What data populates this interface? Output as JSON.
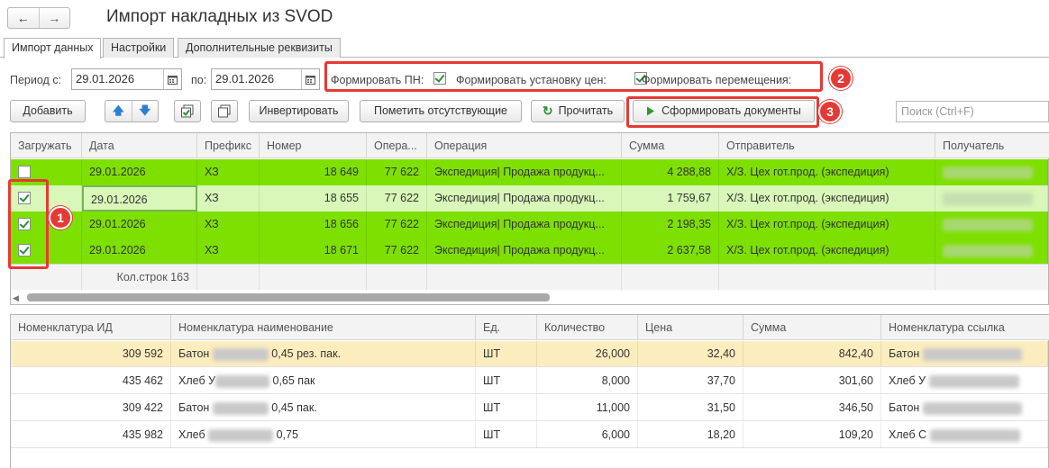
{
  "window": {
    "title": "Импорт накладных из SVOD"
  },
  "nav": {
    "back": "←",
    "forward": "→"
  },
  "tabs": [
    "Импорт данных",
    "Настройки",
    "Дополнительные реквизиты"
  ],
  "filters": {
    "period_from_label": "Период с:",
    "period_from": "29.01.2026",
    "period_to_label": "по:",
    "period_to": "29.01.2026",
    "form_pn_label": "Формировать ПН:",
    "form_prices_label": "Формировать установку цен:",
    "form_moves_label": "Формировать перемещения:",
    "form_pn": true,
    "form_prices": true,
    "form_moves": true
  },
  "toolbar": {
    "add": "Добавить",
    "invert": "Инвертировать",
    "mark_missing": "Пометить отсутствующие",
    "read": "Прочитать",
    "generate": "Сформировать документы",
    "search_placeholder": "Поиск (Ctrl+F)"
  },
  "badges": [
    "1",
    "2",
    "3"
  ],
  "top_table": {
    "columns": [
      "Загружать",
      "Дата",
      "Префикс",
      "Номер",
      "Опера...",
      "Операция",
      "Сумма",
      "Отправитель",
      "Получатель"
    ],
    "rows": [
      {
        "load": false,
        "date": "29.01.2026",
        "prefix": "ХЗ",
        "number": "18 649",
        "op_code": "77 622",
        "operation": "Экспедиция| Продажа продукц...",
        "sum": "4 288,88",
        "sender": "Х/З. Цех гот.прод. (экспедиция)"
      },
      {
        "load": true,
        "date": "29.01.2026",
        "prefix": "ХЗ",
        "number": "18 655",
        "op_code": "77 622",
        "operation": "Экспедиция| Продажа продукц...",
        "sum": "1 759,67",
        "sender": "Х/З. Цех гот.прод. (экспедиция)"
      },
      {
        "load": true,
        "date": "29.01.2026",
        "prefix": "ХЗ",
        "number": "18 656",
        "op_code": "77 622",
        "operation": "Экспедиция| Продажа продукц...",
        "sum": "2 198,35",
        "sender": "Х/З. Цех гот.прод. (экспедиция)"
      },
      {
        "load": true,
        "date": "29.01.2026",
        "prefix": "ХЗ",
        "number": "18 671",
        "op_code": "77 622",
        "operation": "Экспедиция| Продажа продукц...",
        "sum": "2 637,58",
        "sender": "Х/З. Цех гот.прод. (экспедиция)"
      }
    ],
    "footer_count": "Кол.строк 163"
  },
  "bottom_table": {
    "columns": [
      "Номенклатура ИД",
      "Номенклатура наименование",
      "Ед.",
      "Количество",
      "Цена",
      "Сумма",
      "Номенклатура ссылка"
    ],
    "rows": [
      {
        "id": "309 592",
        "name_a": "Батон",
        "name_b": "0,45 рез. пак.",
        "unit": "ШТ",
        "qty": "26,000",
        "price": "32,40",
        "sum": "842,40",
        "link": "Батон"
      },
      {
        "id": "435 462",
        "name_a": "Хлеб У",
        "name_b": "0,65 пак",
        "unit": "ШТ",
        "qty": "8,000",
        "price": "37,70",
        "sum": "301,60",
        "link": "Хлеб У"
      },
      {
        "id": "309 422",
        "name_a": "Батон",
        "name_b": "0,45 пак.",
        "unit": "ШТ",
        "qty": "11,000",
        "price": "31,50",
        "sum": "346,50",
        "link": "Батон"
      },
      {
        "id": "435 982",
        "name_a": "Хлеб",
        "name_b": "0,75",
        "unit": "ШТ",
        "qty": "6,000",
        "price": "18,20",
        "sum": "109,20",
        "link": "Хлеб С"
      }
    ]
  },
  "colors": {
    "row_green": "#7ee000",
    "row_selected": "#d9f7b8",
    "row_highlight": "#fcedbe",
    "accent_red": "#e53935"
  }
}
